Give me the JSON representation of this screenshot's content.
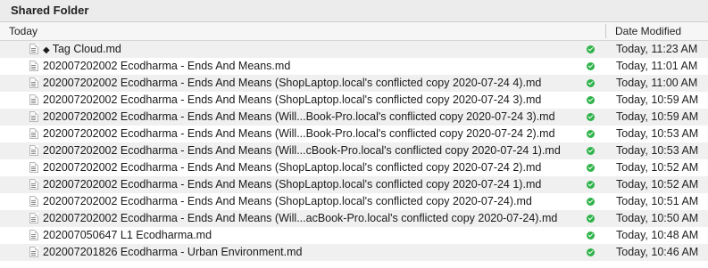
{
  "window": {
    "title": "Shared Folder"
  },
  "header": {
    "group_label": "Today",
    "date_modified_label": "Date Modified"
  },
  "files": [
    {
      "name": "Tag Cloud.md",
      "tag": "◆",
      "date": "Today, 11:23 AM"
    },
    {
      "name": "202007202002 Ecodharma - Ends And Means.md",
      "date": "Today, 11:01 AM"
    },
    {
      "name": "202007202002 Ecodharma - Ends And Means (ShopLaptop.local's conflicted copy 2020-07-24 4).md",
      "date": "Today, 11:00 AM"
    },
    {
      "name": "202007202002 Ecodharma - Ends And Means (ShopLaptop.local's conflicted copy 2020-07-24 3).md",
      "date": "Today, 10:59 AM"
    },
    {
      "name": "202007202002 Ecodharma - Ends And Means (Will...Book-Pro.local's conflicted copy 2020-07-24 3).md",
      "date": "Today, 10:59 AM"
    },
    {
      "name": "202007202002 Ecodharma - Ends And Means (Will...Book-Pro.local's conflicted copy 2020-07-24 2).md",
      "date": "Today, 10:53 AM"
    },
    {
      "name": "202007202002 Ecodharma - Ends And Means (Will...cBook-Pro.local's conflicted copy 2020-07-24 1).md",
      "date": "Today, 10:53 AM"
    },
    {
      "name": "202007202002 Ecodharma - Ends And Means (ShopLaptop.local's conflicted copy 2020-07-24 2).md",
      "date": "Today, 10:52 AM"
    },
    {
      "name": "202007202002 Ecodharma - Ends And Means (ShopLaptop.local's conflicted copy 2020-07-24 1).md",
      "date": "Today, 10:52 AM"
    },
    {
      "name": "202007202002 Ecodharma - Ends And Means (ShopLaptop.local's conflicted copy 2020-07-24).md",
      "date": "Today, 10:51 AM"
    },
    {
      "name": "202007202002 Ecodharma - Ends And Means (Will...acBook-Pro.local's conflicted copy 2020-07-24).md",
      "date": "Today, 10:50 AM"
    },
    {
      "name": "202007050647 L1 Ecodharma.md",
      "date": "Today, 10:48 AM"
    },
    {
      "name": "202007201826 Ecodharma - Urban Environment.md",
      "date": "Today, 10:46 AM"
    }
  ]
}
